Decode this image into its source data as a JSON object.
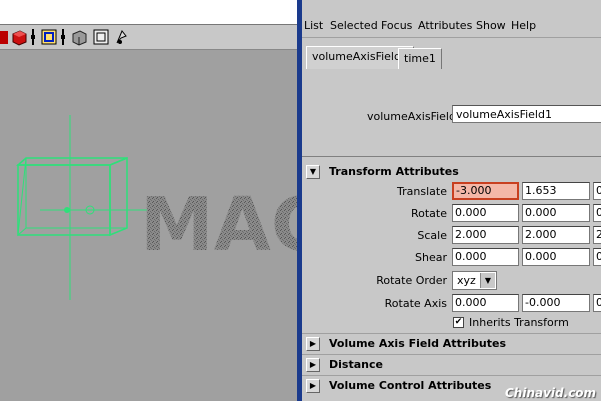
{
  "menu": [
    "List",
    "Selected",
    "Focus",
    "Attributes",
    "Show",
    "Help"
  ],
  "tabs": [
    "volumeAxisField1",
    "time1"
  ],
  "node": {
    "label": "volumeAxisField:",
    "value": "volumeAxisField1"
  },
  "viewport": {
    "text": "MAC"
  },
  "sections": {
    "transform": "Transform Attributes",
    "volume_axis": "Volume Axis Field Attributes",
    "distance": "Distance",
    "volume_control": "Volume Control Attributes"
  },
  "transform": {
    "translate": {
      "label": "Translate",
      "x": "-3.000",
      "y": "1.653",
      "z": "0"
    },
    "rotate": {
      "label": "Rotate",
      "x": "0.000",
      "y": "0.000",
      "z": "0"
    },
    "scale": {
      "label": "Scale",
      "x": "2.000",
      "y": "2.000",
      "z": "2"
    },
    "shear": {
      "label": "Shear",
      "x": "0.000",
      "y": "0.000",
      "z": "0"
    },
    "rotate_order": {
      "label": "Rotate Order",
      "value": "xyz"
    },
    "rotate_axis": {
      "label": "Rotate Axis",
      "x": "0.000",
      "y": "-0.000",
      "z": "0"
    },
    "inherits": {
      "label": "Inherits Transform",
      "checked": true
    }
  },
  "watermark": "Chinavid.com",
  "colors": {
    "accent_divider": "#1a3a8c",
    "manipulator": "#33ee88",
    "highlight_field": "#f4b8a8"
  }
}
